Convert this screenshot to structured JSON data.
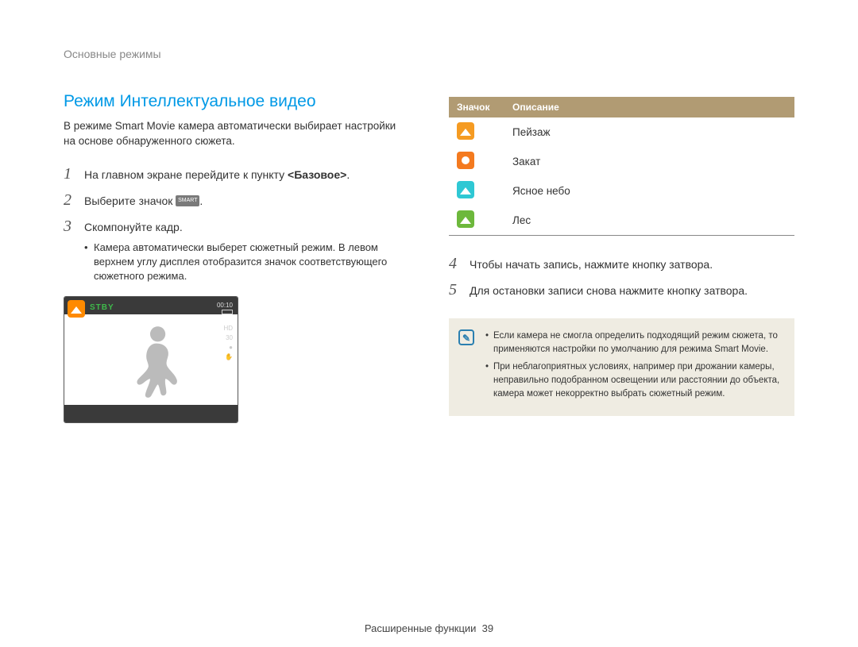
{
  "breadcrumb": "Основные режимы",
  "section_title": "Режим Интеллектуальное видео",
  "intro": "В режиме Smart Movie камера автоматически выбирает настройки на основе обнаруженного сюжета.",
  "steps_left": [
    {
      "num": "1",
      "text_before": "На главном экране перейдите к пункту ",
      "bold": "<Базовое>",
      "text_after": "."
    },
    {
      "num": "2",
      "text_before": "Выберите значок ",
      "icon": "smart-movie-icon",
      "text_after": "."
    },
    {
      "num": "3",
      "text_before": "Скомпонуйте кадр.",
      "bullets": [
        "Камера автоматически выберет сюжетный режим. В левом верхнем углу дисплея отобразится значок соответствующего сюжетного режима."
      ]
    }
  ],
  "preview": {
    "stby": "STBY",
    "time": "00:10",
    "side": [
      "HD",
      "30",
      "●",
      "✋"
    ]
  },
  "table": {
    "headers": [
      "Значок",
      "Описание"
    ],
    "rows": [
      {
        "icon_class": "ticon bg-orange1",
        "name": "landscape-icon",
        "label": "Пейзаж"
      },
      {
        "icon_class": "ticon bg-orange2 sun",
        "name": "sunset-icon",
        "label": "Закат"
      },
      {
        "icon_class": "ticon bg-cyan",
        "name": "clear-sky-icon",
        "label": "Ясное небо"
      },
      {
        "icon_class": "ticon bg-green",
        "name": "forest-icon",
        "label": "Лес"
      }
    ]
  },
  "steps_right": [
    {
      "num": "4",
      "text": "Чтобы начать запись, нажмите кнопку затвора."
    },
    {
      "num": "5",
      "text": "Для остановки записи снова нажмите кнопку затвора."
    }
  ],
  "notes": [
    "Если камера не смогла определить подходящий режим сюжета, то применяются настройки по умолчанию для режима Smart Movie.",
    "При неблагоприятных условиях, например при дрожании камеры, неправильно подобранном освещении или расстоянии до объекта, камера может некорректно выбрать сюжетный режим."
  ],
  "footer": {
    "label": "Расширенные функции",
    "page": "39"
  }
}
